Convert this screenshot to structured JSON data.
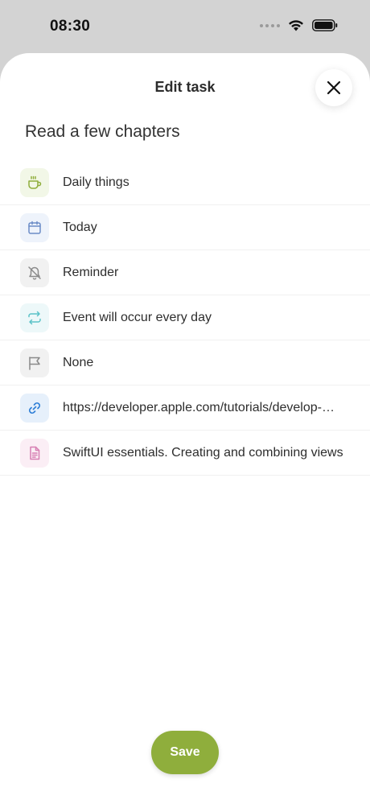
{
  "status_bar": {
    "time": "08:30",
    "icons": [
      "signal-dots-icon",
      "wifi-icon",
      "battery-icon"
    ]
  },
  "sheet": {
    "title": "Edit task",
    "close_icon": "close-icon",
    "task_name": "Read a few chapters"
  },
  "rows": [
    {
      "icon": "cup-icon",
      "label": "Daily things",
      "icon_color": "#8fae3c",
      "icon_bg": "#f2f7e7"
    },
    {
      "icon": "calendar-icon",
      "label": "Today",
      "icon_color": "#6b8cc7",
      "icon_bg": "#eef3fb"
    },
    {
      "icon": "bell-off-icon",
      "label": "Reminder",
      "icon_color": "#8a8a8a",
      "icon_bg": "#f1f1f1"
    },
    {
      "icon": "repeat-icon",
      "label": "Event will occur every day",
      "icon_color": "#5cc3c8",
      "icon_bg": "#edf8f9"
    },
    {
      "icon": "flag-icon",
      "label": "None",
      "icon_color": "#8a8a8a",
      "icon_bg": "#f1f1f1"
    },
    {
      "icon": "link-icon",
      "label": "https://developer.apple.com/tutorials/develop-…",
      "icon_color": "#2f7fd6",
      "icon_bg": "#e6f0fb"
    },
    {
      "icon": "document-icon",
      "label": "SwiftUI essentials. Creating and combining views",
      "icon_color": "#d77fb3",
      "icon_bg": "#fbeef5"
    }
  ],
  "footer": {
    "save_label": "Save"
  },
  "colors": {
    "accent": "#8fae3c",
    "background_dim": "#d3d3d3"
  }
}
